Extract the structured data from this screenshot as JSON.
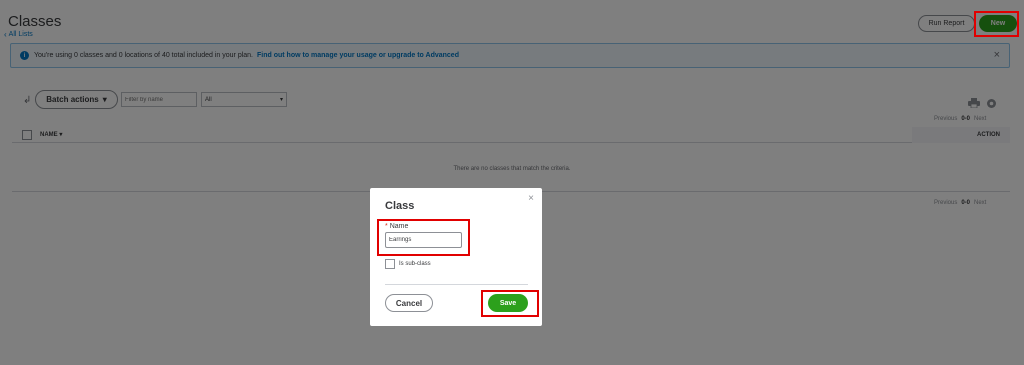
{
  "header": {
    "title": "Classes",
    "back_link": "All Lists",
    "run_report_label": "Run Report",
    "new_label": "New"
  },
  "banner": {
    "message": "You're using 0 classes and 0 locations of 40 total included in your plan.",
    "link_text": "Find out how to manage your usage or upgrade to Advanced"
  },
  "toolbar": {
    "batch_actions_label": "Batch actions",
    "filter_placeholder": "Filter by name",
    "status_filter_value": "All"
  },
  "pager": {
    "previous": "Previous",
    "range": "0-0",
    "next": "Next"
  },
  "table": {
    "columns": [
      "NAME",
      "ACTION"
    ],
    "empty_message": "There are no classes that match the criteria."
  },
  "modal": {
    "title": "Class",
    "name_label": "Name",
    "name_value": "Earrings",
    "subclass_label": "Is sub-class",
    "cancel_label": "Cancel",
    "save_label": "Save"
  },
  "colors": {
    "accent_green": "#2ca01c",
    "link_blue": "#0077c5",
    "highlight_red": "#e10000"
  }
}
